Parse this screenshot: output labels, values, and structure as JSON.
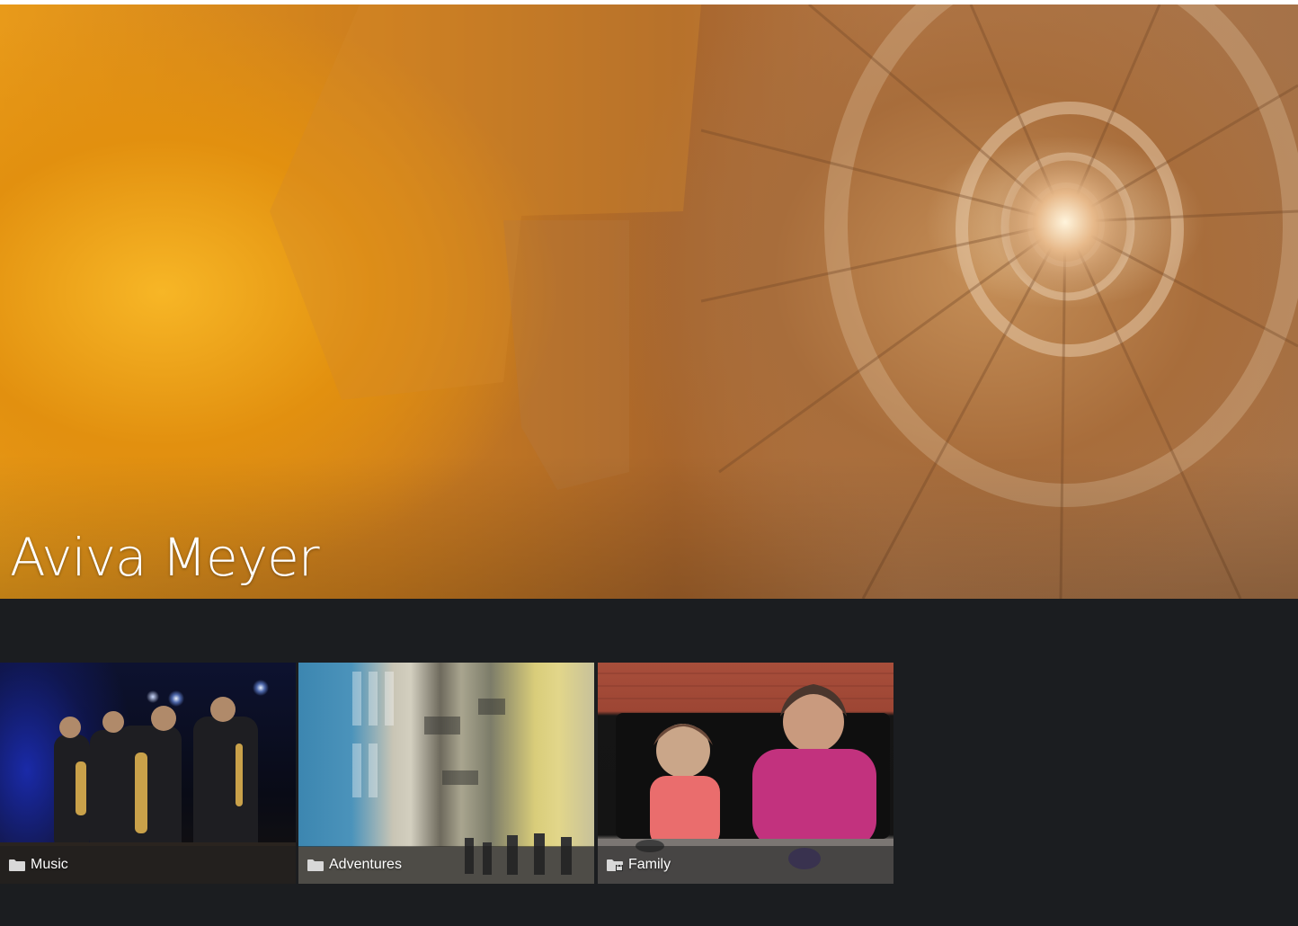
{
  "profile": {
    "name": "Aviva Meyer"
  },
  "albums": [
    {
      "label": "Music",
      "icon": "folder-icon"
    },
    {
      "label": "Adventures",
      "icon": "folder-icon"
    },
    {
      "label": "Family",
      "icon": "folder-lock-icon"
    }
  ],
  "colors": {
    "page_background": "#1b1d20",
    "caption_overlay": "rgba(30,30,30,0.55)",
    "title_text": "#ffffff"
  }
}
